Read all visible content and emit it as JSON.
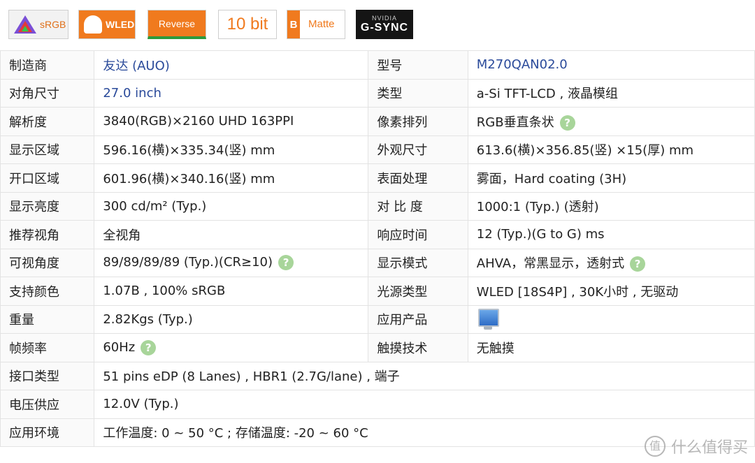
{
  "badges": {
    "srgb": "sRGB",
    "wled": "WLED",
    "reverse": "Reverse",
    "tenbit": "10 bit",
    "matte_letter": "B",
    "matte": "Matte",
    "gsync_top": "NVIDIA",
    "gsync": "G-SYNC"
  },
  "rows": [
    {
      "k1": "制造商",
      "v1": "友达 (AUO)",
      "k2": "型号",
      "v2": "M270QAN02.0"
    },
    {
      "k1": "对角尺寸",
      "v1": "27.0 inch",
      "k2": "类型",
      "v2": "a-Si TFT-LCD , 液晶模组"
    },
    {
      "k1": "解析度",
      "v1": "3840(RGB)×2160   UHD   163PPI",
      "k2": "像素排列",
      "v2": "RGB垂直条状"
    },
    {
      "k1": "显示区域",
      "v1": "596.16(横)×335.34(竖) mm",
      "k2": "外观尺寸",
      "v2": "613.6(横)×356.85(竖) ×15(厚) mm"
    },
    {
      "k1": "开口区域",
      "v1": "601.96(横)×340.16(竖) mm",
      "k2": "表面处理",
      "v2": "雾面，Hard coating (3H)"
    },
    {
      "k1": "显示亮度",
      "v1": "300 cd/m² (Typ.)",
      "k2": "对 比 度",
      "v2": "1000:1 (Typ.) (透射)"
    },
    {
      "k1": "推荐视角",
      "v1": "全视角",
      "k2": "响应时间",
      "v2": "12 (Typ.)(G to G) ms"
    },
    {
      "k1": "可视角度",
      "v1": "89/89/89/89 (Typ.)(CR≥10)",
      "k2": "显示模式",
      "v2": "AHVA，常黑显示，透射式"
    },
    {
      "k1": "支持颜色",
      "v1": "1.07B , 100% sRGB",
      "k2": "光源类型",
      "v2": "WLED  [18S4P] , 30K小时 , 无驱动"
    },
    {
      "k1": "重量",
      "v1": "2.82Kgs (Typ.)",
      "k2": "应用产品",
      "v2": ""
    },
    {
      "k1": "帧频率",
      "v1": "60Hz",
      "k2": "触摸技术",
      "v2": "无触摸"
    }
  ],
  "wide_rows": [
    {
      "k": "接口类型",
      "v": "51 pins   eDP (8 Lanes) , HBR1 (2.7G/lane) , 端子"
    },
    {
      "k": "电压供应",
      "v": "12.0V (Typ.)"
    },
    {
      "k": "应用环境",
      "v": "工作温度: 0 ~ 50 °C ; 存储温度: -20 ~ 60 °C"
    }
  ],
  "help_glyph": "?",
  "watermark": {
    "logo": "值",
    "text": "什么值得买"
  }
}
